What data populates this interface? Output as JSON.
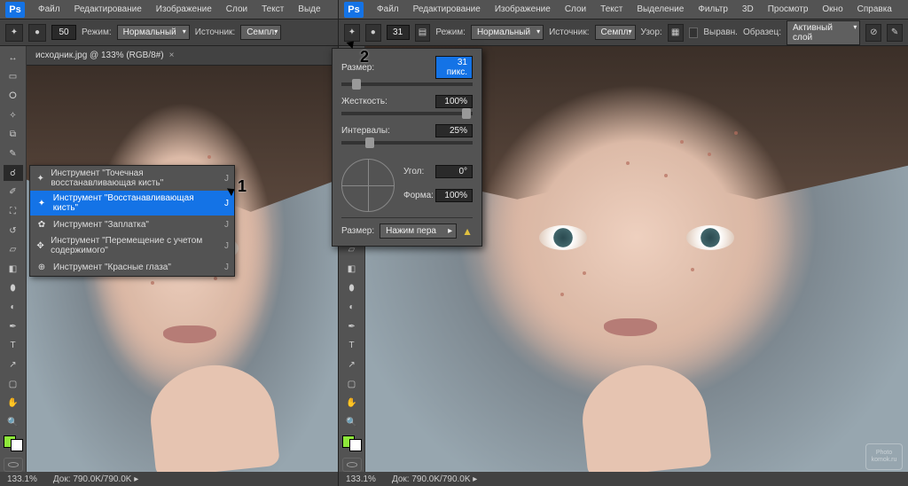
{
  "app": {
    "logo": "Ps"
  },
  "menubar": [
    [
      "Файл",
      "Редактирование",
      "Изображение",
      "Слои",
      "Текст",
      "Выде"
    ],
    [
      "Файл",
      "Редактирование",
      "Изображение",
      "Слои",
      "Текст",
      "Выделение",
      "Фильтр",
      "3D",
      "Просмотр",
      "Окно",
      "Справка"
    ]
  ],
  "optionsBar": {
    "brushSize": "50",
    "brushSize2": "31",
    "modeLabel": "Режим:",
    "mode": "Нормальный",
    "sourceLabel": "Источник:",
    "source": "Семпл.",
    "patternLabel": "Узор:",
    "alignedLabel": "Выравн.",
    "sampleLabel": "Образец:",
    "sample": "Активный слой"
  },
  "docTab": {
    "title": "исходник.jpg @ 133% (RGB/8#)"
  },
  "status": {
    "zoom": "133.1%",
    "docSizeLabel": "Док:",
    "docSize": "790.0K/790.0K"
  },
  "flyout": {
    "items": [
      {
        "shortcut": "J",
        "label": "Инструмент \"Точечная восстанавливающая кисть\""
      },
      {
        "shortcut": "J",
        "label": "Инструмент \"Восстанавливающая кисть\""
      },
      {
        "shortcut": "J",
        "label": "Инструмент \"Заплатка\""
      },
      {
        "shortcut": "J",
        "label": "Инструмент \"Перемещение с учетом содержимого\""
      },
      {
        "shortcut": "J",
        "label": "Инструмент \"Красные глаза\""
      }
    ],
    "selectedIndex": 1
  },
  "brushPopup": {
    "sizeLabel": "Размер:",
    "sizeValue": "31 пикс.",
    "hardnessLabel": "Жесткость:",
    "hardnessValue": "100%",
    "spacingLabel": "Интервалы:",
    "spacingValue": "25%",
    "angleLabel": "Угол:",
    "angleValue": "0°",
    "roundnessLabel": "Форма:",
    "roundnessValue": "100%",
    "sizeModeLabel": "Размер:",
    "sizeMode": "Нажим пера"
  },
  "annotations": {
    "a1": "1",
    "a2": "2"
  },
  "watermark": {
    "l1": "Photo",
    "l2": "komok.ru"
  },
  "tools": [
    "move",
    "marquee",
    "lasso",
    "wand",
    "crop",
    "eyedrop",
    "heal",
    "brush",
    "stamp",
    "history",
    "eraser",
    "gradient",
    "blur",
    "dodge",
    "pen",
    "type",
    "path",
    "shape",
    "hand",
    "zoom"
  ]
}
